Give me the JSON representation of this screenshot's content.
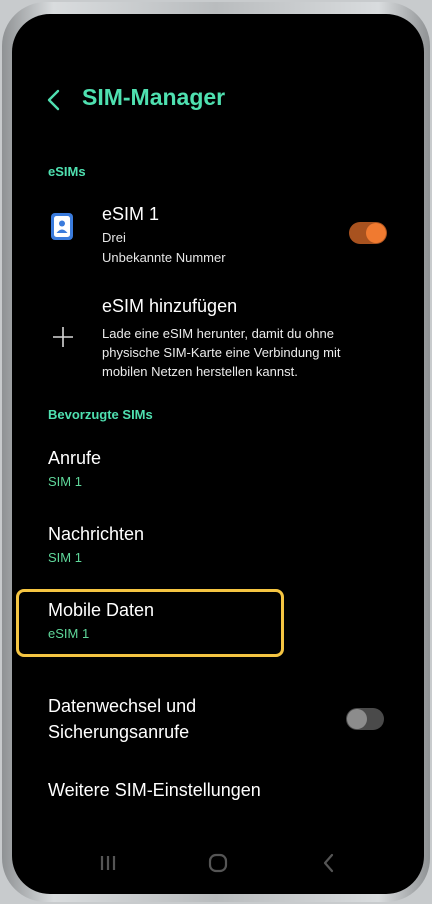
{
  "header": {
    "title": "SIM-Manager"
  },
  "sections": {
    "esims_label": "eSIMs",
    "preferred_label": "Bevorzugte SIMs"
  },
  "esim1": {
    "name": "eSIM 1",
    "carrier": "Drei",
    "number": "Unbekannte Nummer",
    "enabled": true,
    "toggle_color": "#f07a30"
  },
  "add_esim": {
    "title": "eSIM hinzufügen",
    "description": "Lade eine eSIM herunter, damit du ohne physische SIM-Karte eine Verbindung mit mobilen Netzen herstellen kannst."
  },
  "preferred": {
    "calls": {
      "title": "Anrufe",
      "value": "SIM 1"
    },
    "messages": {
      "title": "Nachrichten",
      "value": "SIM 1"
    },
    "mobile_data": {
      "title": "Mobile Daten",
      "value": "eSIM 1"
    }
  },
  "data_switch": {
    "title_line1": "Datenwechsel und",
    "title_line2": "Sicherungsanrufe",
    "enabled": false
  },
  "more_settings": {
    "title": "Weitere SIM-Einstellungen"
  },
  "colors": {
    "accent": "#4fe0b0",
    "highlight": "#f5c542",
    "subtext": "#5fd79a"
  }
}
